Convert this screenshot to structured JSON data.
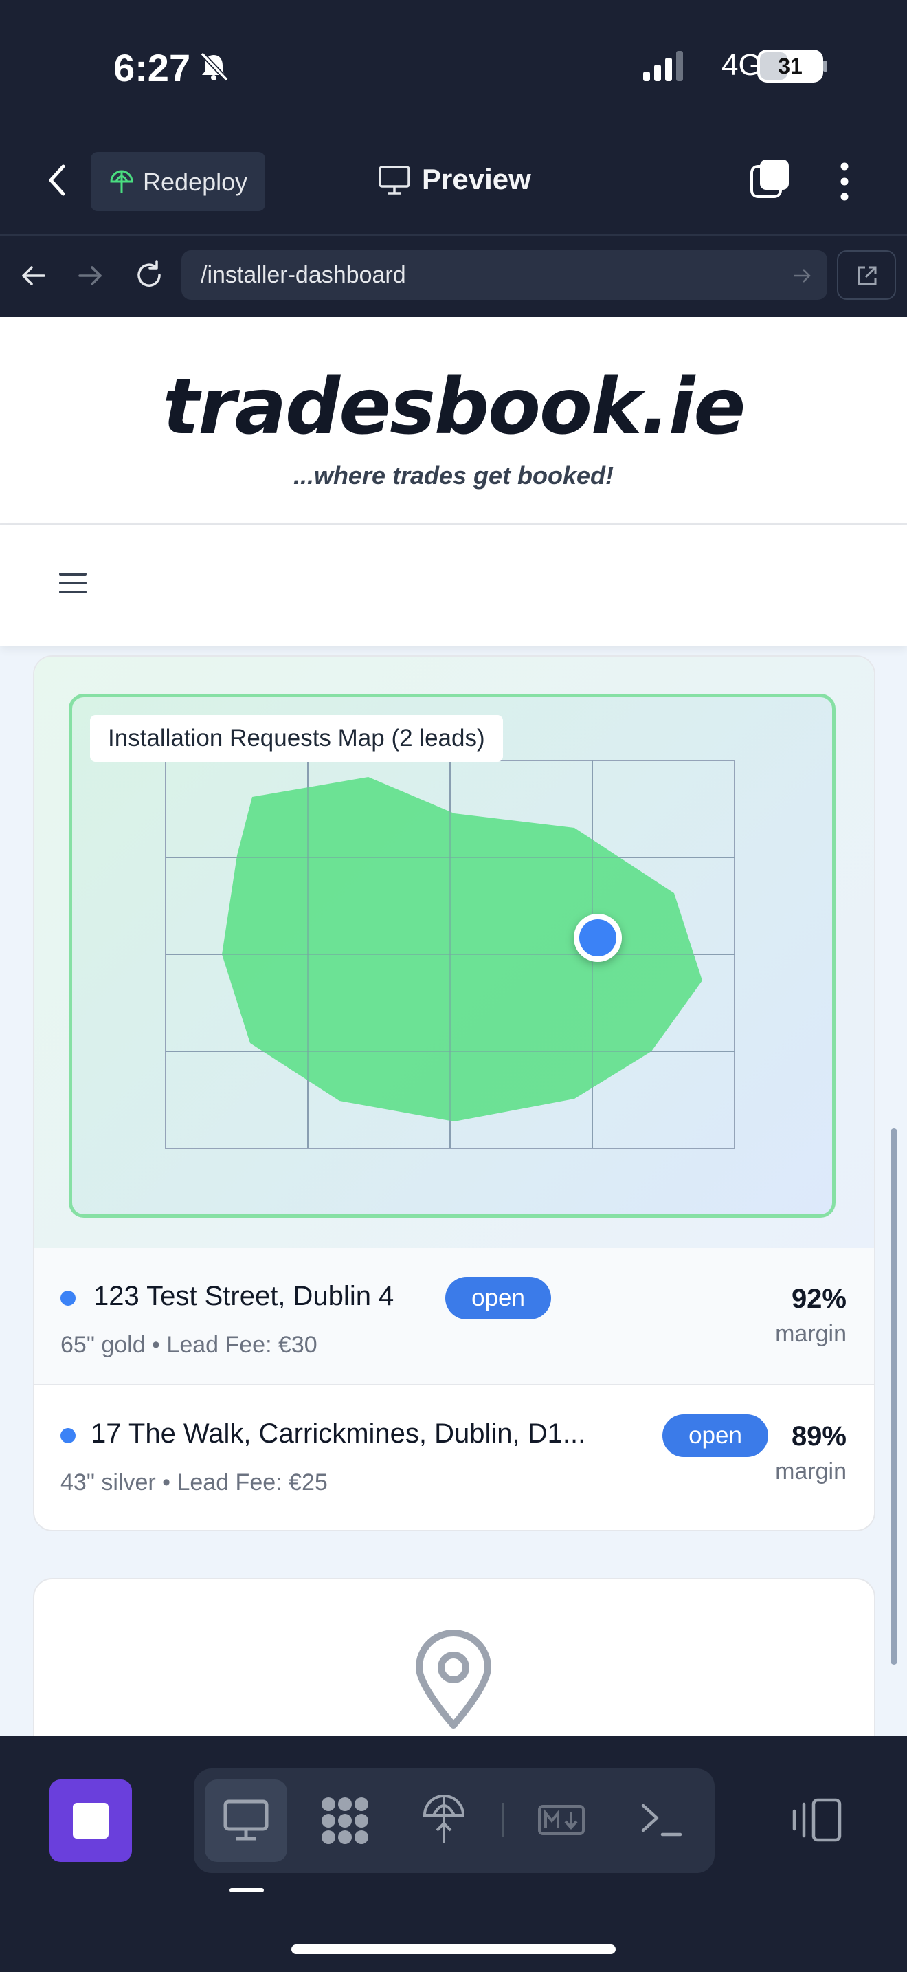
{
  "status_bar": {
    "time": "6:27",
    "network": "4G",
    "battery": "31"
  },
  "toolbar": {
    "redeploy_label": "Redeploy",
    "preview_label": "Preview"
  },
  "browser": {
    "url": "/installer-dashboard"
  },
  "site": {
    "logo": "tradesbook.ie",
    "tagline": "...where trades get booked!"
  },
  "map": {
    "title": "Installation Requests Map (2 leads)",
    "marker_color": "#3b82f6",
    "region_color": "#66e08f"
  },
  "leads": [
    {
      "address": "123 Test Street, Dublin 4",
      "status": "open",
      "details": "65\" gold • Lead Fee: €30",
      "margin_pct": "92%",
      "margin_label": "margin"
    },
    {
      "address": "17 The Walk, Carrickmines, Dublin, D1...",
      "status": "open",
      "details": "43\" silver • Lead Fee: €25",
      "margin_pct": "89%",
      "margin_label": "margin"
    }
  ],
  "bottom_bar": {
    "tabs": [
      "desktop-icon",
      "apps-icon",
      "deploy-icon",
      "markdown-icon",
      "terminal-icon"
    ],
    "accent": "#6a3fdc"
  }
}
